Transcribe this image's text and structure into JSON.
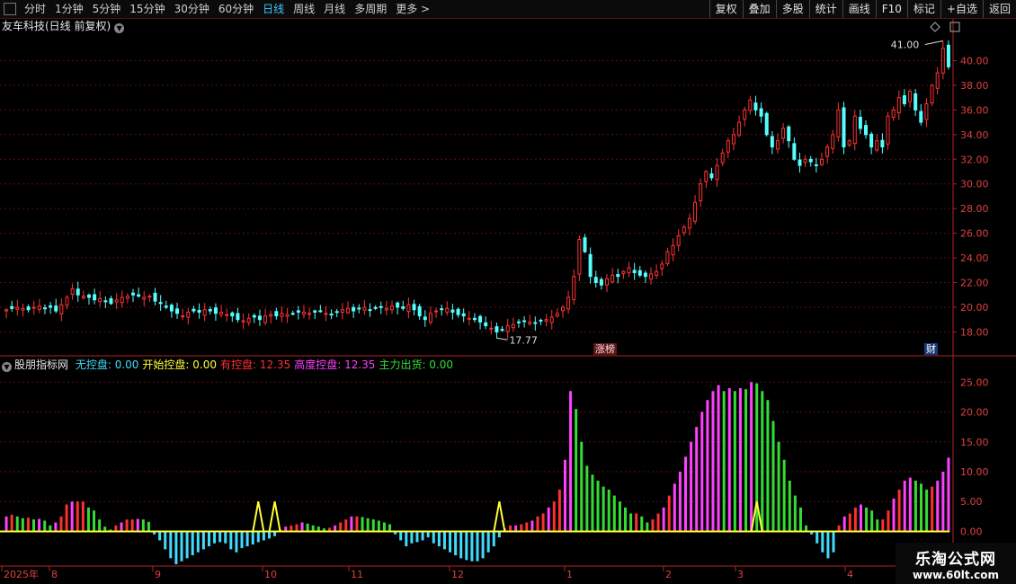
{
  "toolbar": {
    "periods": [
      "分时",
      "1分钟",
      "5分钟",
      "15分钟",
      "30分钟",
      "60分钟",
      "日线",
      "周线",
      "月线",
      "多周期",
      "更多 >"
    ],
    "active": "日线",
    "right_buttons": [
      "复权",
      "叠加",
      "多股",
      "统计",
      "画线",
      "F10",
      "标记",
      "+自选",
      "返回"
    ]
  },
  "main_chart": {
    "title": "友车科技(日线 前复权)",
    "y_ticks": [
      "40.00",
      "38.00",
      "36.00",
      "34.00",
      "32.00",
      "30.00",
      "28.00",
      "26.00",
      "24.00",
      "22.00",
      "20.00",
      "18.00"
    ],
    "high_label": "41.00",
    "low_label": "17.77",
    "tag_zhangbang": "涨榜",
    "tag_cai": "财"
  },
  "indicator": {
    "name": "股朋指标网",
    "items": [
      {
        "label": "无控盘:",
        "value": "0.00",
        "color": "#3fdcff"
      },
      {
        "label": "开始控盘:",
        "value": "0.00",
        "color": "#ffff33"
      },
      {
        "label": "有控盘:",
        "value": "12.35",
        "color": "#ff3030"
      },
      {
        "label": "高度控盘:",
        "value": "12.35",
        "color": "#ff40ff"
      },
      {
        "label": "主力出货:",
        "value": "0.00",
        "color": "#33dd33"
      }
    ],
    "y_ticks": [
      "25.00",
      "20.00",
      "15.00",
      "10.00",
      "5.00",
      "0.00"
    ]
  },
  "x_axis": {
    "labels": [
      "2025年",
      "8",
      "9",
      "10",
      "11",
      "12",
      "1",
      "2",
      "3",
      "4"
    ]
  },
  "colors": {
    "up": "#ff3232",
    "down": "#54ffff",
    "grid": "#5a1010",
    "axis": "#b22222"
  },
  "watermark": {
    "line1": "乐淘公式网",
    "line2": "www.60lt.com"
  },
  "chart_data": {
    "type": "candlestick",
    "main": {
      "ylim": [
        16.5,
        42
      ],
      "closes": [
        19.8,
        19.9,
        20.0,
        19.9,
        19.8,
        20.0,
        20.1,
        19.9,
        20.0,
        19.7,
        20.2,
        20.8,
        21.5,
        21.0,
        20.9,
        20.8,
        20.6,
        20.7,
        20.5,
        20.3,
        20.6,
        20.8,
        20.9,
        21.0,
        20.9,
        20.8,
        20.9,
        20.5,
        20.3,
        20.0,
        19.7,
        19.5,
        19.3,
        19.6,
        19.7,
        19.6,
        19.8,
        19.7,
        19.5,
        19.6,
        19.4,
        19.3,
        19.0,
        18.9,
        19.1,
        19.2,
        19.0,
        19.3,
        19.4,
        19.3,
        19.5,
        19.4,
        19.5,
        19.6,
        19.6,
        19.5,
        19.6,
        19.7,
        19.5,
        19.4,
        19.6,
        19.8,
        19.9,
        19.7,
        19.9,
        20.0,
        19.8,
        19.9,
        20.0,
        19.9,
        20.1,
        20.0,
        19.9,
        20.2,
        19.8,
        19.3,
        19.0,
        19.5,
        19.7,
        19.8,
        19.9,
        19.6,
        19.4,
        19.3,
        19.1,
        19.0,
        18.8,
        18.5,
        18.3,
        18.0,
        18.2,
        18.5,
        18.6,
        18.8,
        18.9,
        18.8,
        18.7,
        18.9,
        19.0,
        19.2,
        19.5,
        20.0,
        20.8,
        22.5,
        25.5,
        24.5,
        22.5,
        22.0,
        21.8,
        22.3,
        22.6,
        22.5,
        22.9,
        23.2,
        22.8,
        22.6,
        22.5,
        22.7,
        22.9,
        23.5,
        24.5,
        25.0,
        25.8,
        26.5,
        27.2,
        28.5,
        30.0,
        31.0,
        30.5,
        31.5,
        32.5,
        33.5,
        34.0,
        35.0,
        36.0,
        36.8,
        36.0,
        35.5,
        34.0,
        33.0,
        33.5,
        34.5,
        33.5,
        32.0,
        31.5,
        32.0,
        31.8,
        31.5,
        32.0,
        33.0,
        34.0,
        36.0,
        33.0,
        33.5,
        35.5,
        34.5,
        34.0,
        33.0,
        33.5,
        33.0,
        35.5,
        36.0,
        37.0,
        36.5,
        37.5,
        36.0,
        35.0,
        36.5,
        38.0,
        39.0,
        41.0,
        39.5
      ]
    },
    "indicator": {
      "ylim": [
        -5.5,
        27
      ],
      "series": [
        {
          "name": "无控盘",
          "color": "#3fdcff"
        },
        {
          "name": "开始控盘",
          "color": "#ffff33"
        },
        {
          "name": "有控盘",
          "color": "#ff3030"
        },
        {
          "name": "高度控盘",
          "color": "#ff40ff"
        },
        {
          "name": "主力出货",
          "color": "#33dd33"
        }
      ],
      "values": [
        2.5,
        2.8,
        2.5,
        2.2,
        2.3,
        2.0,
        2.1,
        1.8,
        1.0,
        1.5,
        2.5,
        4.5,
        5.0,
        5.0,
        5.0,
        4.0,
        3.5,
        2.0,
        0.8,
        0.3,
        1.0,
        1.5,
        2.0,
        2.0,
        2.1,
        2.0,
        1.6,
        -0.5,
        -1.5,
        -3.0,
        -4.5,
        -5.5,
        -5.0,
        -4.5,
        -4.0,
        -3.5,
        -3.0,
        -2.5,
        -2.0,
        -1.8,
        -2.0,
        -3.0,
        -3.5,
        -2.8,
        -2.5,
        -2.2,
        -1.8,
        -1.5,
        -1.2,
        -0.8,
        0.3,
        0.8,
        1.0,
        1.2,
        1.5,
        1.3,
        1.0,
        0.8,
        0.5,
        0.6,
        1.0,
        1.5,
        2.0,
        2.5,
        2.5,
        2.4,
        2.2,
        2.0,
        1.8,
        1.5,
        1.2,
        -0.5,
        -1.5,
        -2.5,
        -2.0,
        -1.8,
        -1.5,
        -1.0,
        -2.0,
        -2.5,
        -3.0,
        -3.5,
        -4.0,
        -4.5,
        -4.8,
        -5.0,
        -5.0,
        -4.5,
        -3.5,
        -2.5,
        -1.0,
        0.5,
        1.0,
        1.0,
        1.2,
        1.5,
        1.8,
        2.5,
        3.0,
        4.0,
        5.0,
        7.0,
        12.0,
        23.5,
        20.5,
        15.0,
        11.0,
        9.5,
        8.5,
        7.5,
        7.0,
        6.0,
        5.0,
        4.0,
        3.0,
        3.0,
        2.5,
        1.5,
        2.0,
        3.0,
        4.0,
        6.0,
        8.0,
        10.0,
        12.5,
        15.0,
        17.5,
        20.0,
        22.0,
        23.5,
        24.5,
        23.5,
        24.0,
        23.5,
        24.0,
        23.8,
        25.0,
        24.8,
        23.5,
        22.0,
        18.5,
        15.0,
        12.0,
        8.5,
        6.0,
        4.0,
        1.0,
        -0.5,
        -2.0,
        -3.5,
        -4.5,
        -3.5,
        1.0,
        2.5,
        3.0,
        4.0,
        4.5,
        4.0,
        3.5,
        2.0,
        2.0,
        3.5,
        5.5,
        7.0,
        8.5,
        9.0,
        8.5,
        8.0,
        7.0,
        7.5,
        8.5,
        10.0,
        12.35
      ],
      "yellow_peaks": [
        46,
        49,
        90,
        137
      ]
    }
  }
}
